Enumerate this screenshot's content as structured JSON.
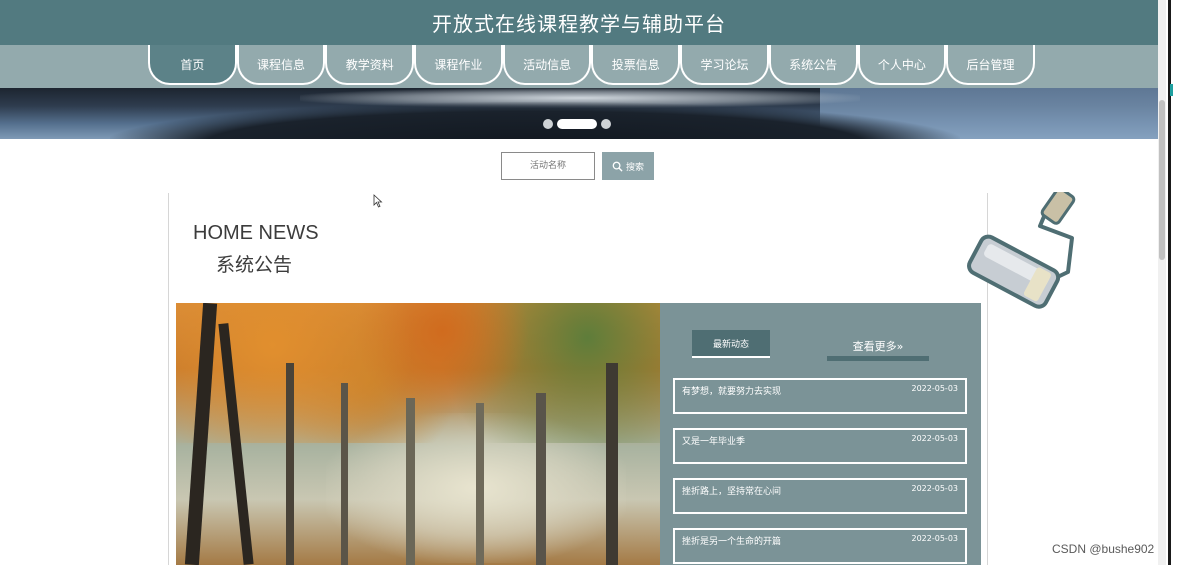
{
  "header": {
    "title": "开放式在线课程教学与辅助平台"
  },
  "nav": {
    "items": [
      {
        "label": "首页"
      },
      {
        "label": "课程信息"
      },
      {
        "label": "教学资料"
      },
      {
        "label": "课程作业"
      },
      {
        "label": "活动信息"
      },
      {
        "label": "投票信息"
      },
      {
        "label": "学习论坛"
      },
      {
        "label": "系统公告"
      },
      {
        "label": "个人中心"
      },
      {
        "label": "后台管理"
      }
    ],
    "active_index": 0
  },
  "carousel": {
    "slides": 3,
    "active_slide": 2
  },
  "search": {
    "placeholder": "活动名称",
    "button_label": "搜索"
  },
  "section": {
    "title_en": "HOME NEWS",
    "title_zh": "系统公告"
  },
  "news": {
    "tab_latest": "最新动态",
    "tab_more": "查看更多»",
    "items": [
      {
        "title": "有梦想，就要努力去实现",
        "date": "2022-05-03"
      },
      {
        "title": "又是一年毕业季",
        "date": "2022-05-03"
      },
      {
        "title": "挫折路上，坚持常在心间",
        "date": "2022-05-03"
      },
      {
        "title": "挫折是另一个生命的开篇",
        "date": "2022-05-03"
      }
    ]
  },
  "colors": {
    "primary": "#527a80",
    "nav_bg": "#93aaad",
    "panel_bg": "#7b9397",
    "tab_active": "#4f6e73"
  },
  "watermark": "CSDN @bushe902"
}
